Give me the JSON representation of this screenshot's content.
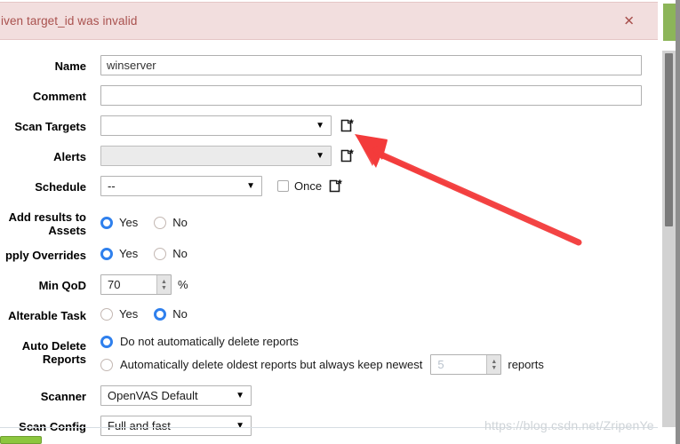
{
  "notification": {
    "message": "iven target_id was invalid",
    "close_label": "✕",
    "bg_color": "#f2dede",
    "text_color": "#a9514e"
  },
  "form": {
    "name": {
      "label": "Name",
      "value": "winserver"
    },
    "comment": {
      "label": "Comment",
      "value": ""
    },
    "scan_targets": {
      "label": "Scan Targets",
      "value": "",
      "caret": "▼"
    },
    "alerts": {
      "label": "Alerts",
      "value": "",
      "caret": "▼"
    },
    "schedule": {
      "label": "Schedule",
      "value": "--",
      "caret": "▼",
      "once_label": "Once"
    },
    "add_results_to_assets": {
      "label": "Add results to Assets",
      "yes_label": "Yes",
      "no_label": "No",
      "selected": "Yes"
    },
    "apply_overrides": {
      "label": "pply Overrides",
      "yes_label": "Yes",
      "no_label": "No",
      "selected": "Yes"
    },
    "min_qod": {
      "label": "Min QoD",
      "value": "70",
      "unit": "%"
    },
    "alterable_task": {
      "label": "Alterable Task",
      "yes_label": "Yes",
      "no_label": "No",
      "selected": "No"
    },
    "auto_delete_reports": {
      "label": "Auto Delete Reports",
      "option_keep_label": "Do not automatically delete reports",
      "option_delete_label": "Automatically delete oldest reports but always keep newest",
      "keep_count": "5",
      "reports_suffix": "reports",
      "selected": "Do not automatically delete reports"
    },
    "scanner": {
      "label": "Scanner",
      "value": "OpenVAS Default",
      "caret": "▼"
    },
    "scan_config": {
      "label": "Scan Config",
      "value": "Full and fast",
      "caret": "▼"
    }
  },
  "watermark": {
    "text": "https://blog.csdn.net/ZripenYe"
  },
  "annotation": {
    "arrow_color": "#f33b3b"
  },
  "spinner": {
    "up": "▲",
    "down": "▼"
  }
}
